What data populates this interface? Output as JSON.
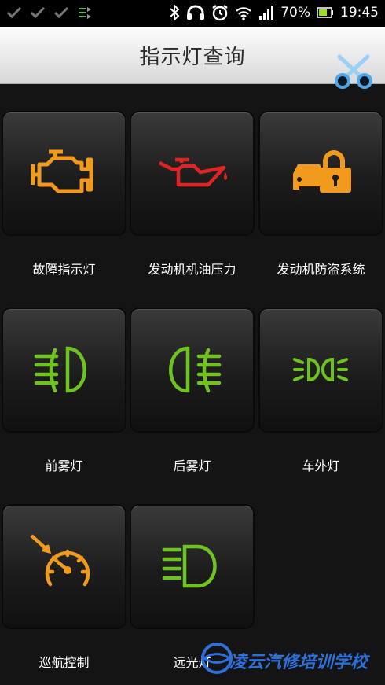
{
  "status_bar": {
    "battery": "70%",
    "time": "19:45",
    "icons": [
      "check-icon",
      "check-icon",
      "check-icon",
      "sync-icon",
      "bluetooth-icon",
      "headset-icon",
      "alarm-icon",
      "wifi-icon",
      "signal-icon",
      "battery-icon"
    ]
  },
  "header": {
    "title": "指示灯查询",
    "tools_icon": "scissors-tools-icon"
  },
  "indicators": [
    {
      "label": "故障指示灯",
      "icon": "engine-check-icon",
      "color": "#f29a1e"
    },
    {
      "label": "发动机机油压力",
      "icon": "oil-pressure-icon",
      "color": "#e02424"
    },
    {
      "label": "发动机防盗系统",
      "icon": "immobilizer-icon",
      "color": "#f29a1e"
    },
    {
      "label": "前雾灯",
      "icon": "front-fog-light-icon",
      "color": "#6ec320"
    },
    {
      "label": "后雾灯",
      "icon": "rear-fog-light-icon",
      "color": "#6ec320"
    },
    {
      "label": "车外灯",
      "icon": "exterior-lights-icon",
      "color": "#6ec320"
    },
    {
      "label": "巡航控制",
      "icon": "cruise-control-icon",
      "color": "#f29a1e"
    },
    {
      "label": "远光灯",
      "icon": "high-beam-icon",
      "color": "#6ec320"
    }
  ],
  "watermark": {
    "text": "凌云汽修培训学校",
    "color": "#2f6fd8"
  }
}
